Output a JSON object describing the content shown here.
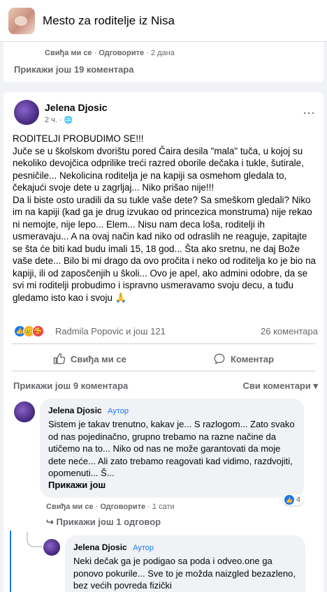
{
  "header": {
    "title": "Mesto za roditelje iz Nisa"
  },
  "top_card": {
    "comment_meta": {
      "like": "Свиђа ми се",
      "reply": "Одговорите",
      "time": "2 дана"
    },
    "show_more": "Прикажи још 19 коментара"
  },
  "post": {
    "author": "Jelena Djosic",
    "time": "2 ч. · ",
    "globe_icon": "globe-icon",
    "more_icon": "⋯",
    "body": [
      "RODITELJI PROBUDIMO SE!!!",
      "Juče se u školskom dvorištu pored Čaira desila \"mala\" tuča, u kojoj su nekoliko devojčica odprilike treći razred oborile dečaka i tukle, šutirale, pesničile... Nekolicina roditelja je na kapiji sa osmehom gledala to, čekajući svoje dete u zagrljaj... Niko prišao nije!!!",
      "Da li biste osto uradili da su tukle vaše dete? Sa smeškom gledali? Niko im na kapiji (kad ga je drug izvukao od princezica monstruma) nije rekao ni nemojte, nije lepo... Elem... Nisu nam deca loša, roditelji ih usmeravaju... A na ovaj način kad niko od odraslih ne reaguje, zapitajte se šta će biti kad budu imali 15, 18 god... Šta ako sretnu, ne daj Bože vaše dete... Bilo bi mi drago da ovo pročita i neko od roditelja ko je bio na kapiji, ili od zaposčenjih u školi... Ovo je apel, ako admini odobre, da se svi mi roditelji probudimo i ispravno usmeravamo svoju decu, a tuđu gledamo isto kao i svoju 🙏"
    ],
    "reactions": {
      "reactors": "Radmila Popovic и још 121",
      "comments": "26 коментара",
      "colors": {
        "like": "#1877f2",
        "sad": "#f7b125",
        "love": "#f33e58"
      }
    },
    "actions": {
      "like": "Свиђа ми се",
      "comment": "Коментар"
    },
    "show_more": "Прикажи још 9 коментара",
    "all_comments": "Сви коментари ▾"
  },
  "comments": [
    {
      "author": "Jelena Djosic",
      "tag": "Аутор",
      "text": "Sistem je takav trenutno, kakav je... S razlogom... Zato svako od nas pojedinačno, grupno trebamo na razne načine da utičemo na to... Niko od nas ne može garantovati da moje dete neće... Ali zato trebamo reagovati kad vidimo, razdvojiti, opomenuti... Š...",
      "see_more": "Прикажи још",
      "reactions": "4",
      "meta": {
        "like": "Свиђа ми се",
        "reply": "Одговорите",
        "time": "1 сати"
      },
      "replies_link": "↪ Прикажи још 1 одговор"
    },
    {
      "author": "Jelena Djosic",
      "tag": "Аутор",
      "text": "Neki dečak ga je podigao sa poda i odveo.one ga ponovo pokurile... Sve to je možda naizgled bezazleno, bez većih povreda fizički"
    }
  ],
  "accent": "#1877f2"
}
